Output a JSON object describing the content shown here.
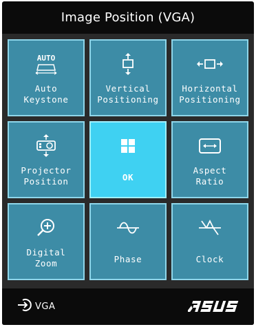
{
  "title": "Image Position (VGA)",
  "tiles": [
    {
      "label": "Auto\nKeystone",
      "icon": "auto-keystone-icon",
      "icon_text": "AUTO"
    },
    {
      "label": "Vertical\nPositioning",
      "icon": "vertical-arrows-icon"
    },
    {
      "label": "Horizontal\nPositioning",
      "icon": "horizontal-arrows-icon"
    },
    {
      "label": "Projector\nPosition",
      "icon": "projector-icon"
    },
    {
      "label": "OK",
      "icon": "grid-icon",
      "selected": true
    },
    {
      "label": "Aspect\nRatio",
      "icon": "aspect-ratio-icon"
    },
    {
      "label": "Digital\nZoom",
      "icon": "zoom-in-icon"
    },
    {
      "label": "Phase",
      "icon": "phase-wave-icon"
    },
    {
      "label": "Clock",
      "icon": "clock-wave-icon"
    }
  ],
  "footer": {
    "source_label": "VGA",
    "source_icon": "input-source-icon",
    "brand": "ASUS"
  },
  "colors": {
    "tile": "#3d8ca6",
    "tile_selected": "#3fd1f2",
    "tile_border": "#8fd6ea",
    "background": "#0b0b0b"
  }
}
